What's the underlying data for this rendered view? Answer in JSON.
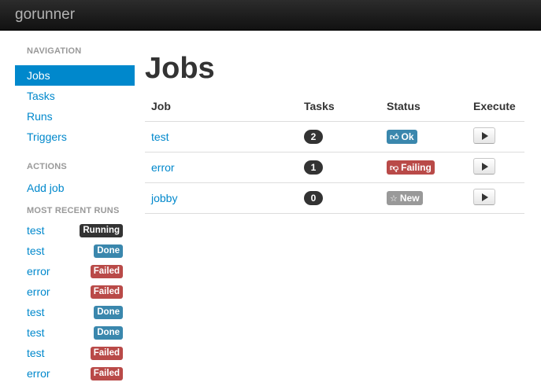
{
  "brand": "gorunner",
  "sidebar": {
    "navigation_header": "NAVIGATION",
    "nav_items": [
      {
        "label": "Jobs",
        "active": true
      },
      {
        "label": "Tasks",
        "active": false
      },
      {
        "label": "Runs",
        "active": false
      },
      {
        "label": "Triggers",
        "active": false
      }
    ],
    "actions_header": "ACTIONS",
    "action_items": [
      {
        "label": "Add job"
      }
    ],
    "recent_header": "MOST RECENT RUNS",
    "recent_runs": [
      {
        "name": "test",
        "status": "Running",
        "color": "#333333"
      },
      {
        "name": "test",
        "status": "Done",
        "color": "#3a87ad"
      },
      {
        "name": "error",
        "status": "Failed",
        "color": "#b94a48"
      },
      {
        "name": "error",
        "status": "Failed",
        "color": "#b94a48"
      },
      {
        "name": "test",
        "status": "Done",
        "color": "#3a87ad"
      },
      {
        "name": "test",
        "status": "Done",
        "color": "#3a87ad"
      },
      {
        "name": "test",
        "status": "Failed",
        "color": "#b94a48"
      },
      {
        "name": "error",
        "status": "Failed",
        "color": "#b94a48"
      }
    ]
  },
  "main": {
    "title": "Jobs",
    "columns": [
      "Job",
      "Tasks",
      "Status",
      "Execute"
    ],
    "jobs": [
      {
        "name": "test",
        "tasks": "2",
        "status": "Ok",
        "status_icon": "thumbs-up-icon",
        "status_color": "#3a87ad"
      },
      {
        "name": "error",
        "tasks": "1",
        "status": "Failing",
        "status_icon": "thumbs-down-icon",
        "status_color": "#b94a48"
      },
      {
        "name": "jobby",
        "tasks": "0",
        "status": "New",
        "status_icon": "star-icon",
        "status_color": "#999999"
      }
    ]
  }
}
